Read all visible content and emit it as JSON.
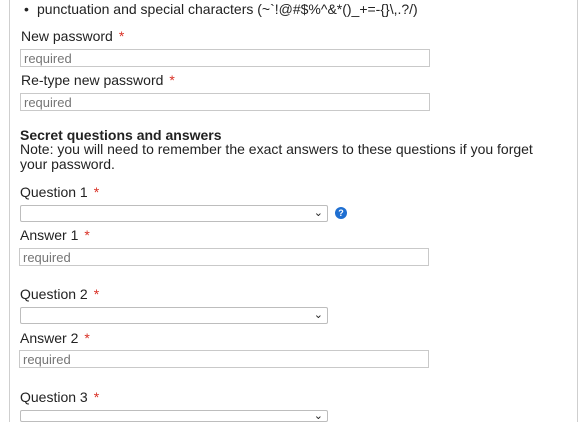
{
  "rules": {
    "punctuation": "punctuation and special characters (~`!@#$%^&*()_+=-{}\\,.?/)"
  },
  "password": {
    "new_label": "New password",
    "new_placeholder": "required",
    "retype_label": "Re-type new password",
    "retype_placeholder": "required",
    "required_mark": "*"
  },
  "secret": {
    "heading": "Secret questions and answers",
    "note": "Note: you will need to remember the exact answers to these questions if you forget your password.",
    "question1_label": "Question 1",
    "answer1_label": "Answer 1",
    "answer1_placeholder": "required",
    "question2_label": "Question 2",
    "answer2_label": "Answer 2",
    "answer2_placeholder": "required",
    "question3_label": "Question 3",
    "required_mark": "*"
  },
  "icons": {
    "bullet": "•",
    "chevron": "⌄",
    "help": "?"
  },
  "colors": {
    "required_mark": "#d93025",
    "help_icon": "#1f6fd1",
    "placeholder": "#9a9a9a"
  }
}
